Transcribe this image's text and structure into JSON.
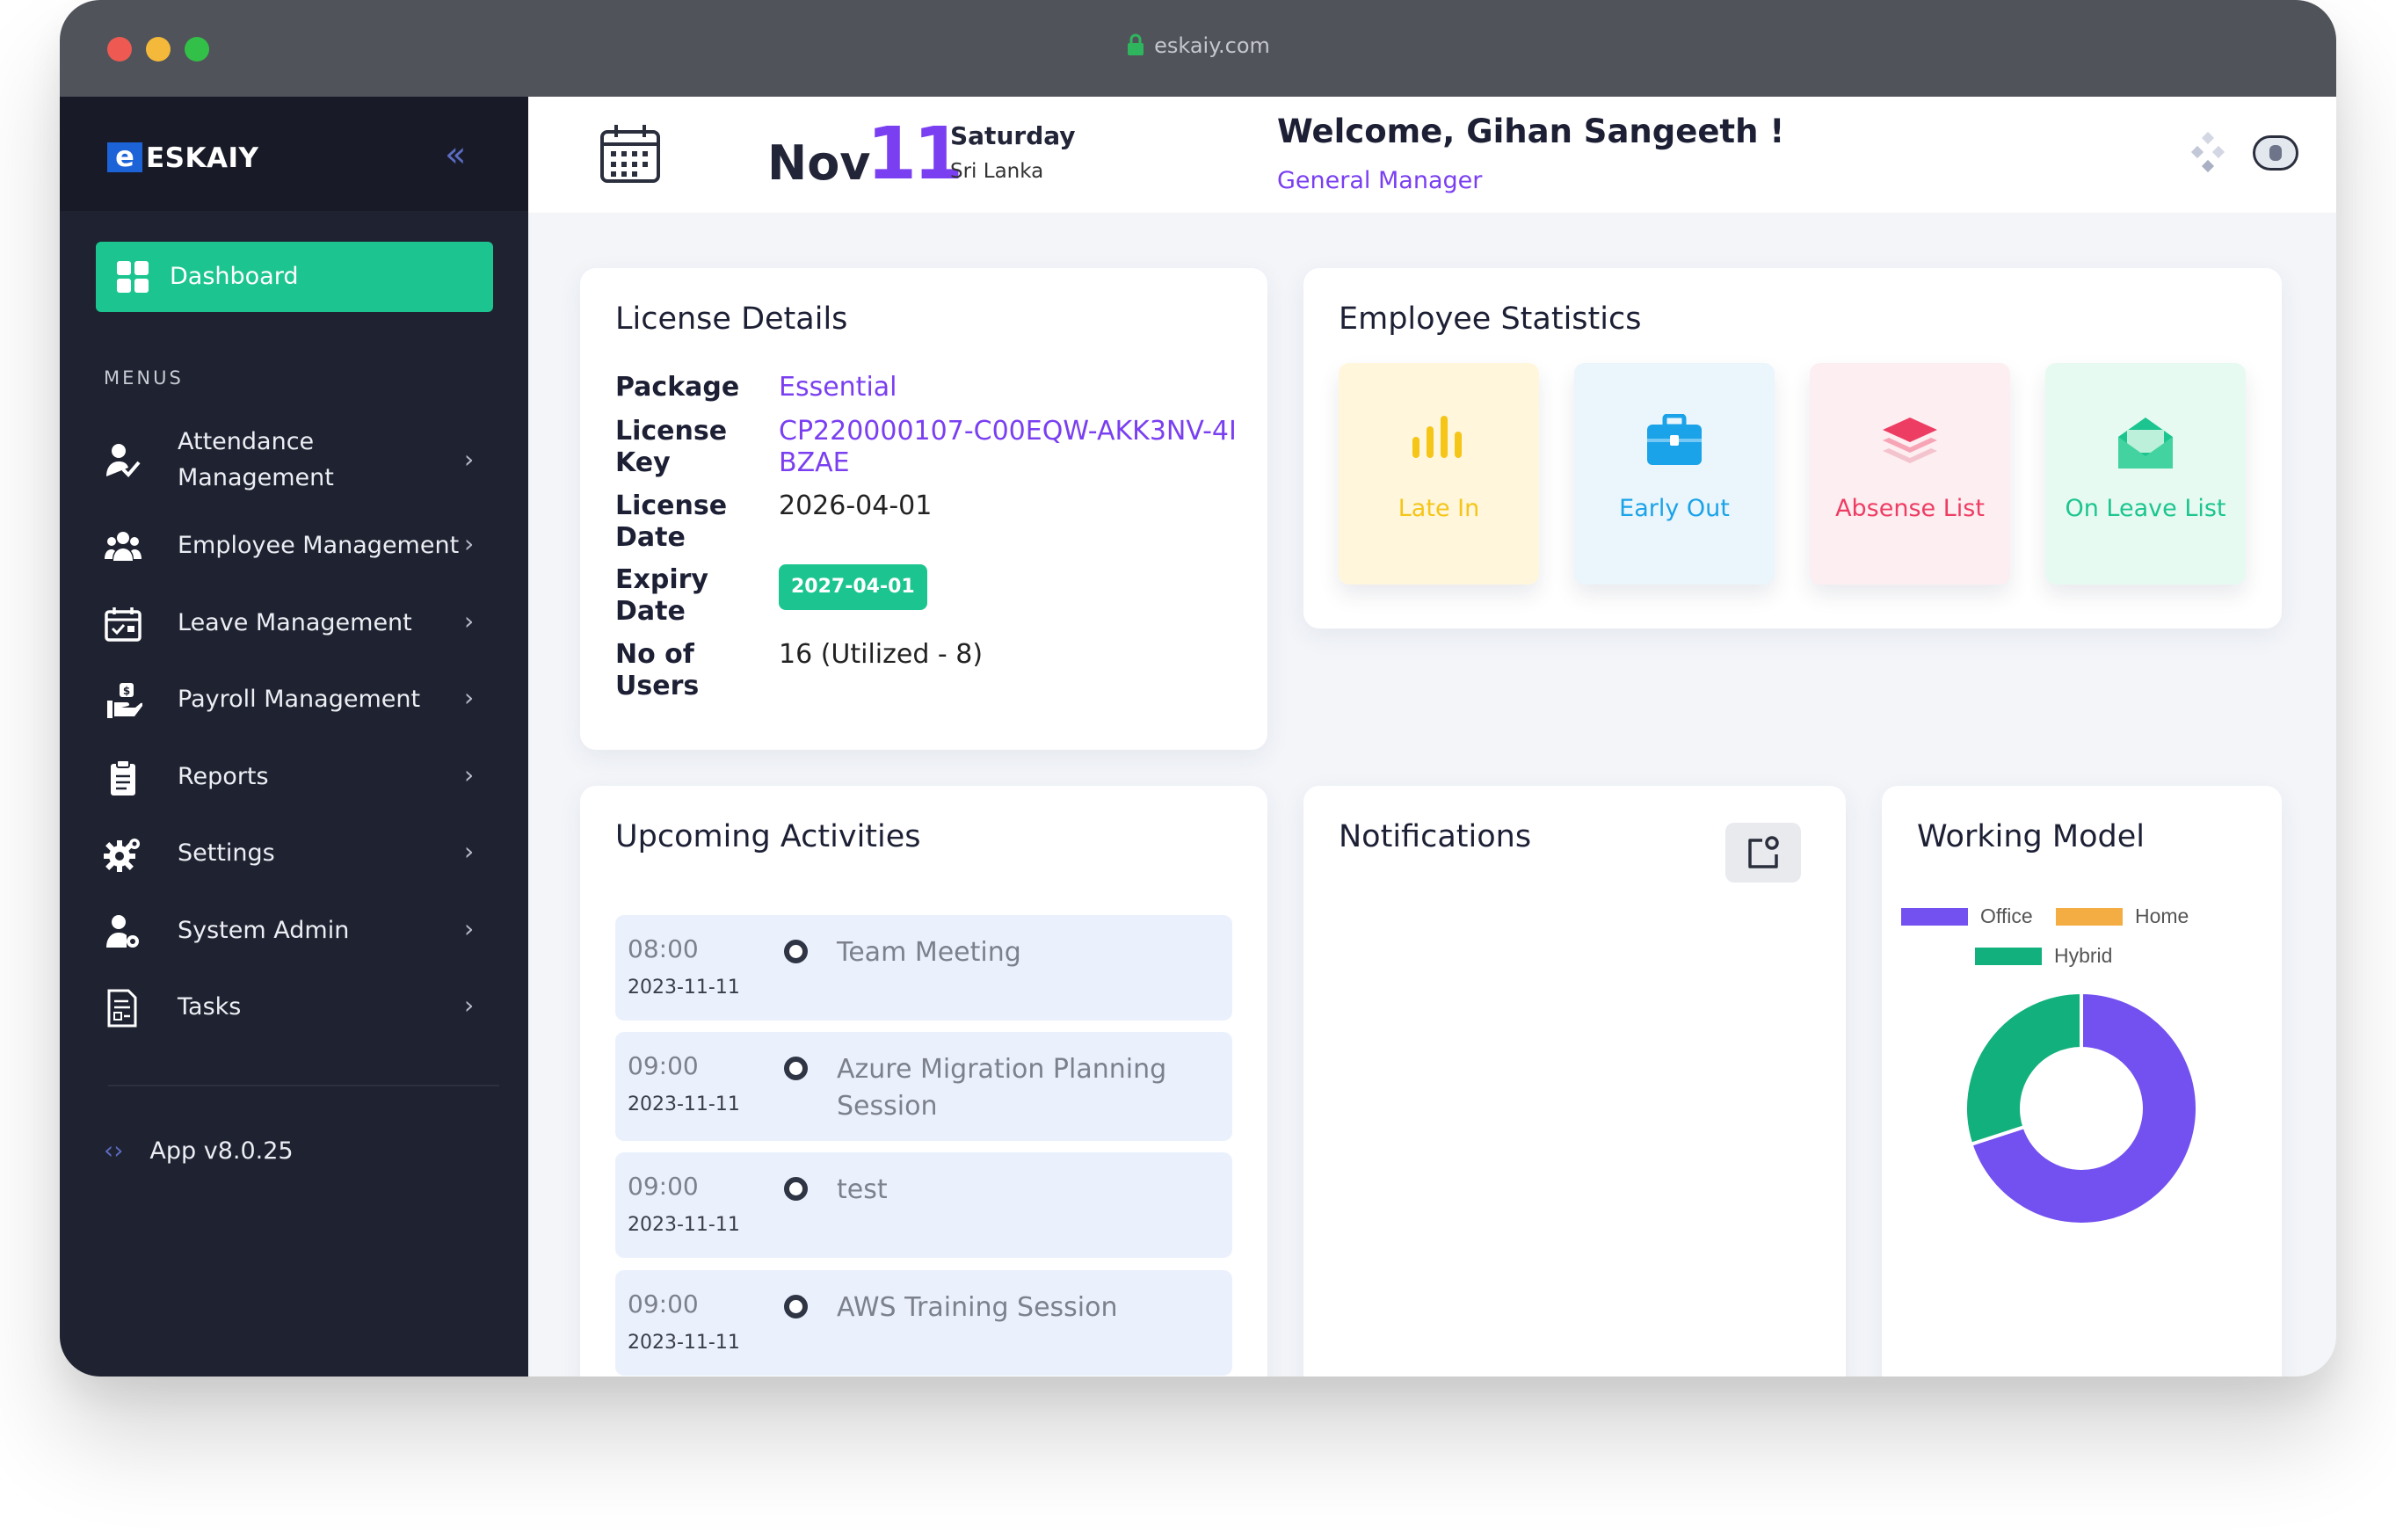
{
  "browser": {
    "url": "eskaiy.com"
  },
  "sidebar": {
    "logo_mark": "e",
    "logo_text": "ESKAIY",
    "active_item": {
      "label": "Dashboard",
      "color": "#1cc58f"
    },
    "section_title": "MENUS",
    "items": [
      {
        "label": "Attendance Management",
        "icon": "attendance-icon"
      },
      {
        "label": "Employee Management",
        "icon": "employees-icon"
      },
      {
        "label": "Leave Management",
        "icon": "leave-calendar-icon"
      },
      {
        "label": "Payroll Management",
        "icon": "payroll-icon"
      },
      {
        "label": "Reports",
        "icon": "clipboard-icon"
      },
      {
        "label": "Settings",
        "icon": "gear-icon"
      },
      {
        "label": "System Admin",
        "icon": "admin-user-icon"
      },
      {
        "label": "Tasks",
        "icon": "tasks-icon"
      }
    ],
    "version": "App v8.0.25"
  },
  "header": {
    "month": "Nov",
    "day": "11",
    "weekday": "Saturday",
    "country": "Sri Lanka",
    "welcome": "Welcome, Gihan Sangeeth !",
    "role": "General Manager"
  },
  "license": {
    "title": "License Details",
    "rows": [
      {
        "key": "Package",
        "value": "Essential"
      },
      {
        "key": "License Key",
        "value": "CP220000107-C00EQW-AKK3NV-4IBZAE"
      },
      {
        "key": "License Date",
        "value": "2026-04-01"
      },
      {
        "key": "Expiry Date",
        "value": "2027-04-01"
      },
      {
        "key": "No of Users",
        "value": "16 (Utilized - 8)"
      }
    ]
  },
  "stats": {
    "title": "Employee Statistics",
    "tiles": [
      {
        "label": "Late In",
        "icon": "bar-chart-icon",
        "bg": "#fff6dc",
        "color": "#f5c518"
      },
      {
        "label": "Early Out",
        "icon": "briefcase-icon",
        "bg": "#eaf5fc",
        "color": "#1aa3e8"
      },
      {
        "label": "Absense List",
        "icon": "layers-icon",
        "bg": "#fdeef1",
        "color": "#ee3d63"
      },
      {
        "label": "On Leave List",
        "icon": "envelope-icon",
        "bg": "#e7faf1",
        "color": "#1cc58f"
      }
    ]
  },
  "activities": {
    "title": "Upcoming Activities",
    "items": [
      {
        "time": "08:00",
        "date": "2023-11-11",
        "title": "Team Meeting"
      },
      {
        "time": "09:00",
        "date": "2023-11-11",
        "title": "Azure Migration Planning Session"
      },
      {
        "time": "09:00",
        "date": "2023-11-11",
        "title": "test"
      },
      {
        "time": "09:00",
        "date": "2023-11-11",
        "title": "AWS Training Session"
      }
    ]
  },
  "notifications": {
    "title": "Notifications"
  },
  "working_model": {
    "title": "Working Model",
    "chart_data": {
      "type": "pie",
      "labels": [
        "Office",
        "Home",
        "Hybrid"
      ],
      "values": [
        70,
        0,
        30
      ],
      "colors": [
        "#7350f0",
        "#f3ad43",
        "#12b07c"
      ],
      "legend": "top"
    }
  }
}
